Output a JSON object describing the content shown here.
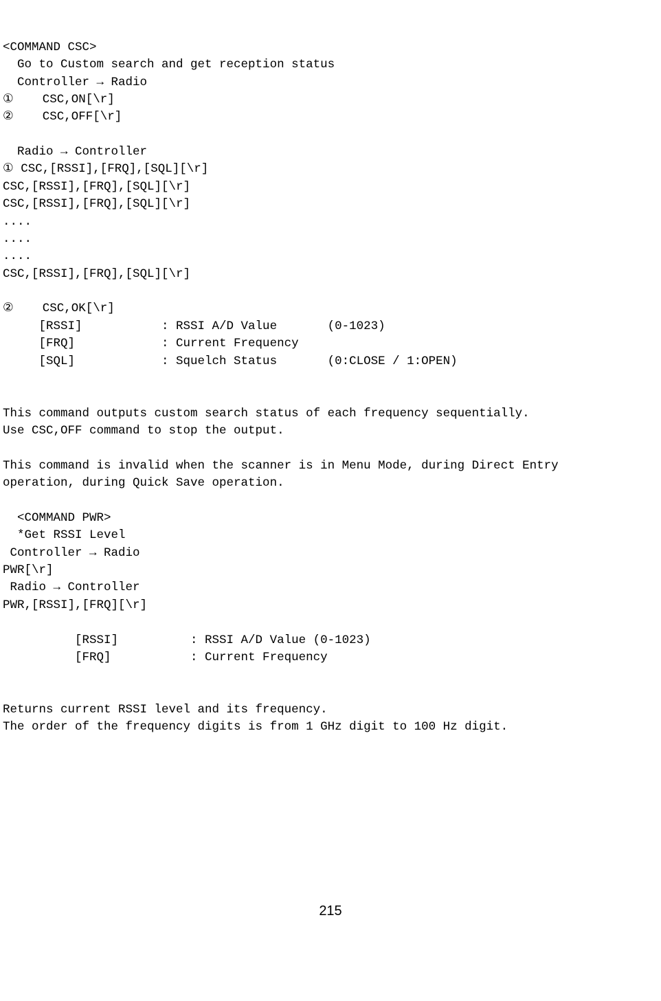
{
  "csc": {
    "header": "<COMMAND CSC>",
    "title": "  Go to Custom search and get reception status",
    "dir1": "  Controller → Radio",
    "cmd1": "①    CSC,ON[\\r]",
    "cmd2": "②    CSC,OFF[\\r]",
    "dir2": "  Radio → Controller",
    "resp1": "① CSC,[RSSI],[FRQ],[SQL][\\r]",
    "resp2": "CSC,[RSSI],[FRQ],[SQL][\\r]",
    "resp3": "CSC,[RSSI],[FRQ],[SQL][\\r]",
    "dots1": "....",
    "dots2": "....",
    "dots3": "....",
    "resp4": "CSC,[RSSI],[FRQ],[SQL][\\r]",
    "ok": "②    CSC,OK[\\r]",
    "param_rssi": "     [RSSI]           : RSSI A/D Value       (0-1023)",
    "param_frq": "     [FRQ]            : Current Frequency",
    "param_sql": "     [SQL]            : Squelch Status       (0:CLOSE / 1:OPEN)",
    "desc1": "This command outputs custom search status of each frequency sequentially.",
    "desc2": "Use CSC,OFF command to stop the output.",
    "desc3": "This command is invalid when the scanner is in Menu Mode, during Direct Entry",
    "desc4": "operation, during Quick Save operation."
  },
  "pwr": {
    "header": "  <COMMAND PWR>",
    "title": "  *Get RSSI Level",
    "dir1": " Controller → Radio",
    "cmd1": "PWR[\\r]",
    "dir2": " Radio → Controller",
    "resp1": "PWR,[RSSI],[FRQ][\\r]",
    "param_rssi": "          [RSSI]          : RSSI A/D Value (0-1023)",
    "param_frq": "          [FRQ]           : Current Frequency",
    "desc1": "Returns current RSSI level and its frequency.",
    "desc2": "The order of the frequency digits is from 1 GHz digit to 100 Hz digit."
  },
  "page_number": "215"
}
